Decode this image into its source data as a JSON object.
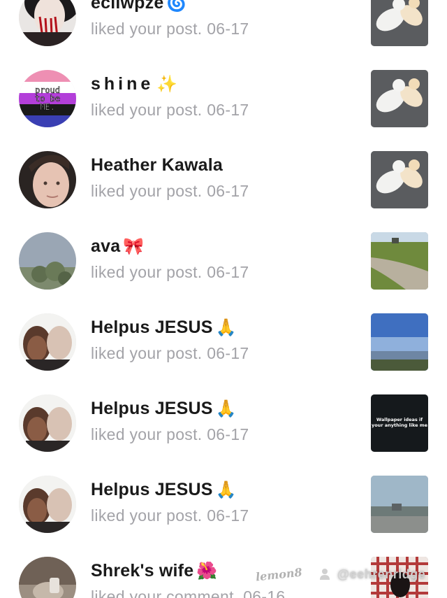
{
  "notifications": [
    {
      "name": "ecliwpze",
      "emoji": "🌀",
      "action": "liked your post.",
      "date": "06-17",
      "avatar_icon": "red-drip-avatar-photo",
      "thumb_icon": "cats-playing-thumbnail"
    },
    {
      "name": "shine",
      "emoji": "✨",
      "action": "liked your post.",
      "date": "06-17",
      "avatar_icon": "proud-to-be-me-flag-avatar",
      "avatar_text": [
        "proud",
        "to be",
        "ME."
      ],
      "thumb_icon": "cats-playing-thumbnail"
    },
    {
      "name": "Heather Kawala",
      "emoji": "",
      "action": "liked your post.",
      "date": "06-17",
      "avatar_icon": "child-face-avatar-photo",
      "thumb_icon": "cats-playing-thumbnail"
    },
    {
      "name": "ava",
      "emoji": "🎀",
      "action": "liked your post.",
      "date": "06-17",
      "avatar_icon": "sky-tree-avatar-photo",
      "thumb_icon": "field-road-thumbnail"
    },
    {
      "name": "Helpus JESUS",
      "emoji": "🙏",
      "action": "liked your post.",
      "date": "06-17",
      "avatar_icon": "couple-selfie-avatar-photo",
      "thumb_icon": "lake-sky-thumbnail"
    },
    {
      "name": "Helpus JESUS",
      "emoji": "🙏",
      "action": "liked your post.",
      "date": "06-17",
      "avatar_icon": "couple-selfie-avatar-photo",
      "thumb_icon": "dark-wallpaper-thumbnail",
      "thumb_text": [
        "Wallpaper ideas if",
        "your anything like me"
      ]
    },
    {
      "name": "Helpus JESUS",
      "emoji": "🙏",
      "action": "liked your post.",
      "date": "06-17",
      "avatar_icon": "couple-selfie-avatar-photo",
      "thumb_icon": "highway-sky-thumbnail"
    },
    {
      "name": "Shrek's wife",
      "emoji": "🌺",
      "action": "liked your comment.",
      "date": "06-16",
      "avatar_icon": "bathroom-mirror-avatar-photo",
      "thumb_icon": "plaid-pattern-thumbnail"
    }
  ],
  "watermark": {
    "logo": "lemon8",
    "handle": "@eehrenridge",
    "icon": "user-icon"
  }
}
